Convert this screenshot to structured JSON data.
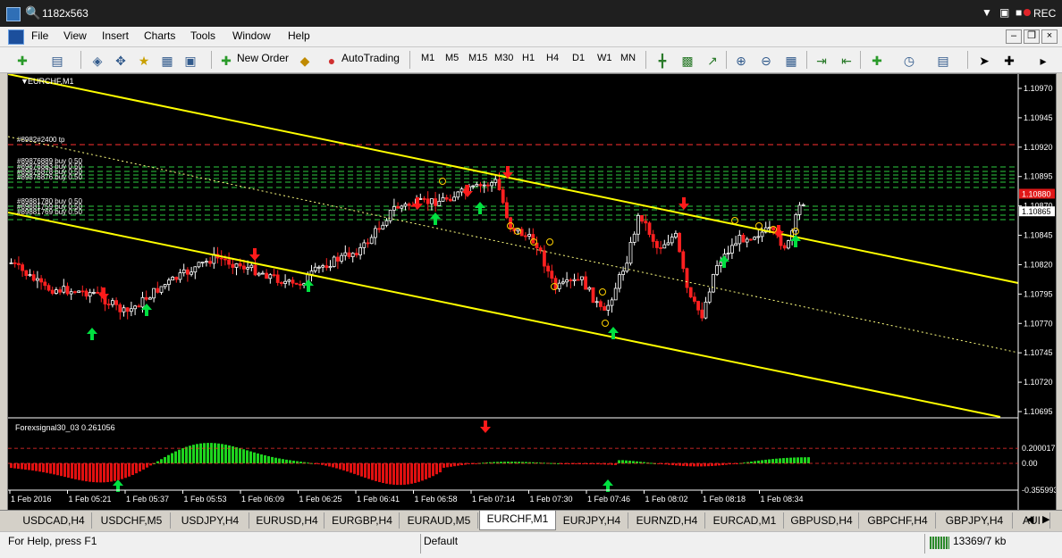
{
  "window": {
    "title": "1182x563",
    "rec": "REC"
  },
  "menu": [
    "File",
    "View",
    "Insert",
    "Charts",
    "Tools",
    "Window",
    "Help"
  ],
  "toolbar": {
    "new_order": "New Order",
    "autotrading": "AutoTrading",
    "timeframes": [
      "M1",
      "M5",
      "M15",
      "M30",
      "H1",
      "H4",
      "D1",
      "W1",
      "MN"
    ]
  },
  "chart": {
    "symbol_label": "EURCHF,M1",
    "price_axis": [
      "1.10970",
      "1.10945",
      "1.10920",
      "1.10895",
      "1.10870",
      "1.10845",
      "1.10820",
      "1.10795",
      "1.10770",
      "1.10745",
      "1.10720",
      "1.10695"
    ],
    "price_tags": [
      {
        "text": "1.10880",
        "color": "#e01818"
      },
      {
        "text": "1.10865",
        "color": "#ffffff"
      }
    ],
    "order_labels": [
      "#8982#2400 tp",
      "#89876889 buy 0.50",
      "#89876883 buy 0.50",
      "#89876878 buy 0.50",
      "#89876876 buy 0.50",
      "#89881780 buy 0.50",
      "#89881759 buy 0.50",
      "#89881769 buy 0.50"
    ],
    "indicator_label": "Forexsignal30_03 0.261056",
    "indicator_axis": [
      "0.200017",
      "0.00",
      "-0.355993"
    ],
    "time_axis": [
      "1 Feb 2016",
      "1 Feb 05:21",
      "1 Feb 05:37",
      "1 Feb 05:53",
      "1 Feb 06:09",
      "1 Feb 06:25",
      "1 Feb 06:41",
      "1 Feb 06:58",
      "1 Feb 07:14",
      "1 Feb 07:30",
      "1 Feb 07:46",
      "1 Feb 08:02",
      "1 Feb 08:18",
      "1 Feb 08:34"
    ],
    "colors": {
      "bull": "#ffffff",
      "bear": "#ff2020",
      "channel": "#ffff00",
      "buy_level": "#2ecc40",
      "tp_level": "#ff3030",
      "hist_up": "#1ed41e",
      "hist_down": "#e01010"
    }
  },
  "tabs": [
    "USDCAD,H4",
    "USDCHF,M5",
    "USDJPY,H4",
    "EURUSD,H4",
    "EURGBP,H4",
    "EURAUD,M5",
    "EURCHF,M1",
    "EURJPY,H4",
    "EURNZD,H4",
    "EURCAD,M1",
    "GBPUSD,H4",
    "GBPCHF,H4",
    "GBPJPY,H4",
    "AUI"
  ],
  "active_tab": "EURCHF,M1",
  "status": {
    "help": "For Help, press F1",
    "profile": "Default",
    "traffic": "13369/7 kb"
  }
}
